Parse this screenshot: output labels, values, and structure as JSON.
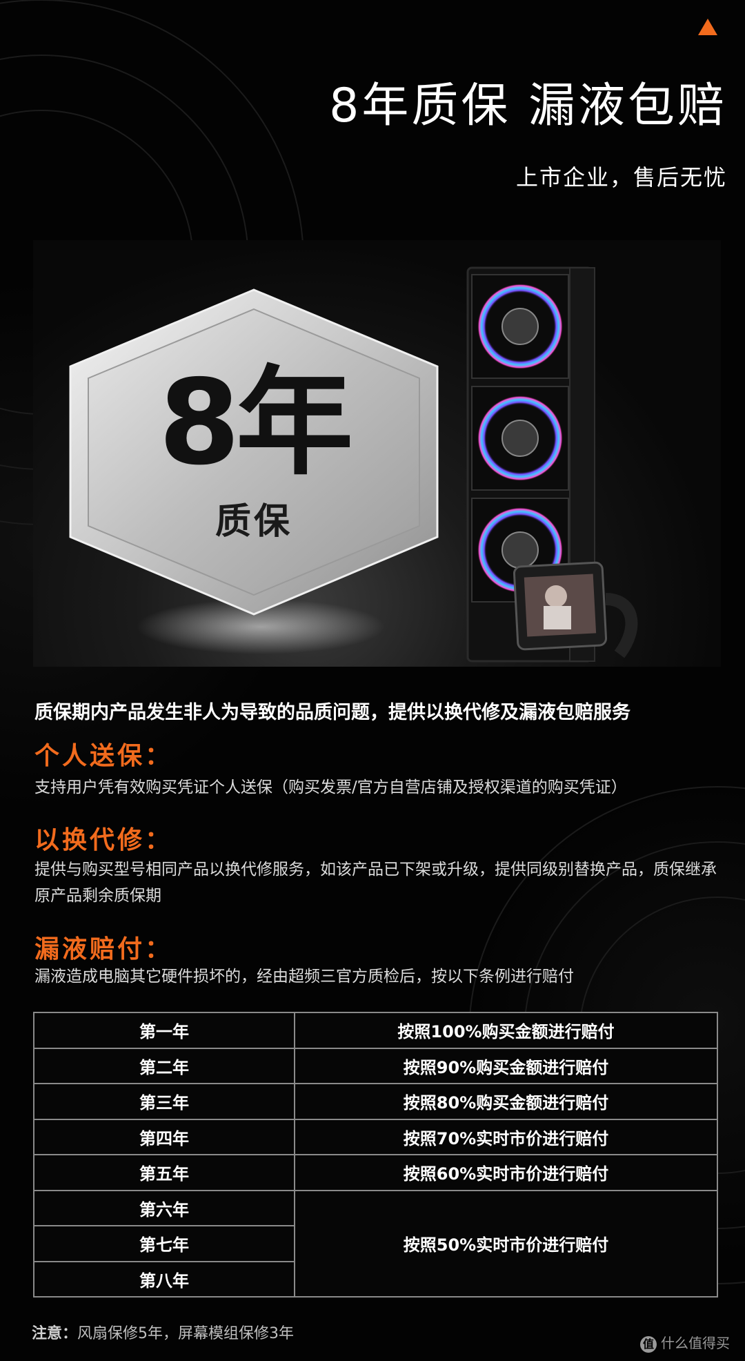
{
  "header": {
    "title": "8年质保 漏液包赔",
    "subtitle": "上市企业，售后无忧"
  },
  "hero": {
    "badge_big": "8年",
    "badge_small": "质保"
  },
  "intro": "质保期内产品发生非人为导致的品质问题，提供以换代修及漏液包赔服务",
  "sections": [
    {
      "title": "个人送保：",
      "text": "支持用户凭有效购买凭证个人送保（购买发票/官方自营店铺及授权渠道的购买凭证）"
    },
    {
      "title": "以换代修：",
      "text": "提供与购买型号相同产品以换代修服务，如该产品已下架或升级，提供同级别替换产品，质保继承原产品剩余质保期"
    },
    {
      "title": "漏液赔付：",
      "text": "漏液造成电脑其它硬件损坏的，经由超频三官方质检后，按以下条例进行赔付"
    }
  ],
  "table": {
    "rows": [
      {
        "year": "第一年",
        "terms": "按照100%购买金额进行赔付"
      },
      {
        "year": "第二年",
        "terms": "按照90%购买金额进行赔付"
      },
      {
        "year": "第三年",
        "terms": "按照80%购买金额进行赔付"
      },
      {
        "year": "第四年",
        "terms": "按照70%实时市价进行赔付"
      },
      {
        "year": "第五年",
        "terms": "按照60%实时市价进行赔付"
      },
      {
        "year": "第六年",
        "terms": "按照50%实时市价进行赔付"
      },
      {
        "year": "第七年",
        "terms": ""
      },
      {
        "year": "第八年",
        "terms": ""
      }
    ]
  },
  "note": {
    "label": "注意：",
    "text": "风扇保修5年，屏幕模组保修3年"
  },
  "watermark": "什么值得买",
  "colors": {
    "accent": "#f26b1d",
    "background": "#030303",
    "table_border": "#8a8a8a"
  }
}
